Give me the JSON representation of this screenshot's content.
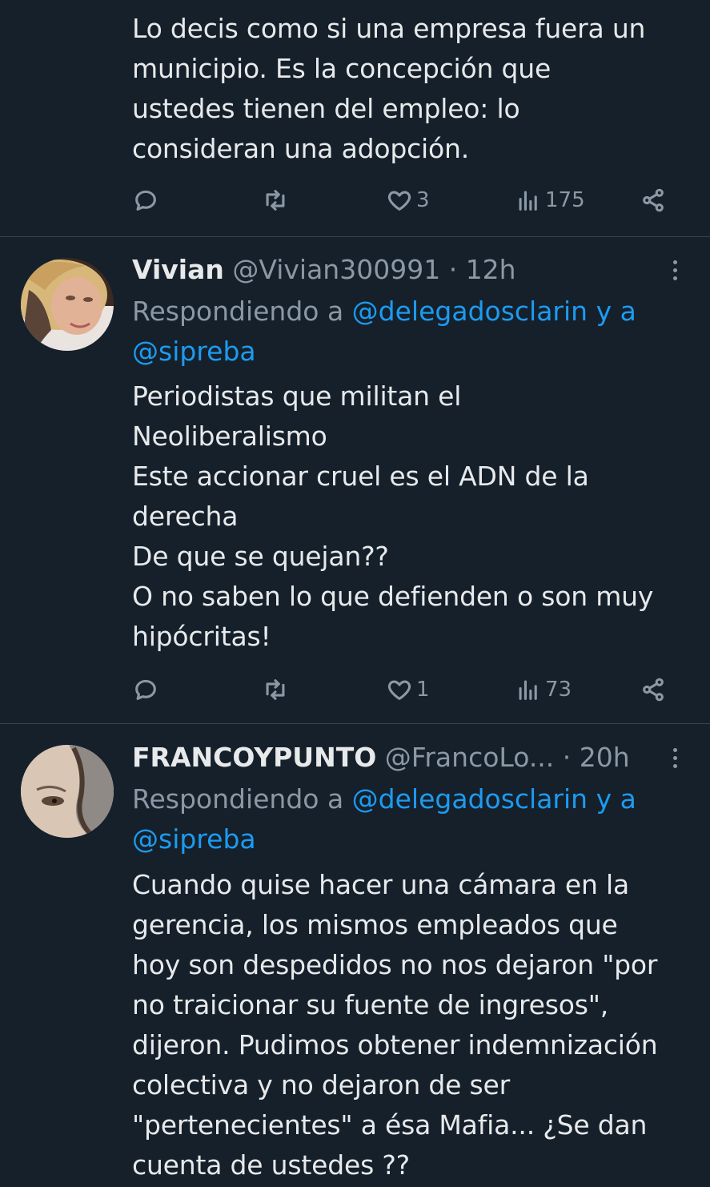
{
  "tweets": [
    {
      "text": "Lo decis como si una empresa fuera un\nmunicipio. Es la concepción que\nustedes tienen del empleo: lo\nconsideran una adopción.",
      "likes": "3",
      "views": "175"
    },
    {
      "display_name": "Vivian",
      "handle": "@Vivian300991",
      "dot": "·",
      "time": "12h",
      "replying_prefix": "Respondiendo a ",
      "replying_mention_1": "@delegadosclarin y a",
      "replying_mention_2": "@sipreba",
      "text": "Periodistas que militan el\nNeoliberalismo\nEste accionar cruel es el ADN de la\nderecha\nDe que se quejan??\nO no saben lo que defienden o son muy\nhipócritas!",
      "likes": "1",
      "views": "73"
    },
    {
      "display_name": "FRANCOYPUNTO",
      "handle": "@FrancoLo...",
      "dot": "·",
      "time": "20h",
      "replying_prefix": "Respondiendo a ",
      "replying_mention_1": "@delegadosclarin y a",
      "replying_mention_2": "@sipreba",
      "text": "Cuando quise hacer una cámara en la\ngerencia, los mismos empleados que\nhoy son despedidos no nos dejaron \"por\nno traicionar su fuente de ingresos\",\ndijeron. Pudimos obtener indemnización\ncolectiva y no dejaron de ser\n\"pertenecientes\" a ésa Mafia... ¿Se dan\ncuenta de ustedes ??"
    }
  ],
  "icons": {
    "reply": "reply-icon",
    "retweet": "retweet-icon",
    "like": "heart-icon",
    "views": "views-icon",
    "share": "share-icon",
    "more": "more-icon"
  },
  "colors": {
    "background": "#15202b",
    "text": "#e7e9ea",
    "muted": "#8b98a5",
    "accent": "#1d9bf0",
    "divider": "#38444d"
  }
}
